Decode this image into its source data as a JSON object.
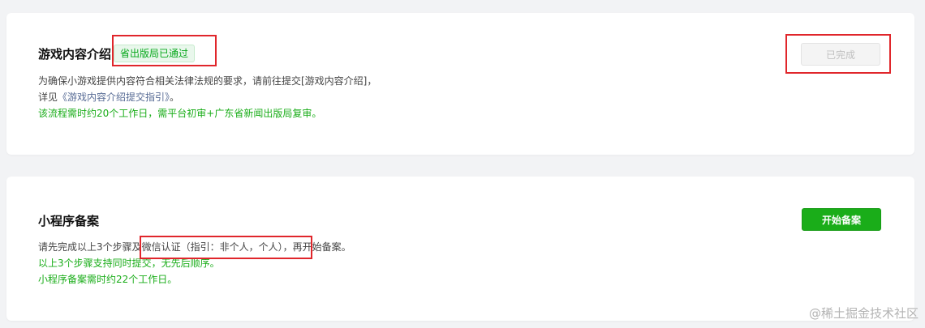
{
  "section_game": {
    "title": "游戏内容介绍",
    "badge": "省出版局已通过",
    "desc_line1": "为确保小游戏提供内容符合相关法律法规的要求，请前往提交[游戏内容介绍]，",
    "desc_line2_prefix": "详见",
    "desc_line2_link": "《游戏内容介绍提交指引》",
    "desc_line2_suffix": "。",
    "desc_line3": "该流程需时约20个工作日，需平台初审+广东省新闻出版局复审。",
    "button_label": "已完成"
  },
  "section_filing": {
    "title": "小程序备案",
    "desc_line1": "请先完成以上3个步骤及微信认证（指引：非个人，个人），再开始备案。",
    "desc_line2": "以上3个步骤支持同时提交，无先后顺序。",
    "desc_line3": "小程序备案需时约22个工作日。",
    "button_label": "开始备案"
  },
  "watermark": "@稀土掘金技术社区",
  "colors": {
    "brand_green": "#1aad19",
    "highlight_red": "#e0262b",
    "link_blue": "#576b95",
    "page_background": "#f2f3f5"
  }
}
